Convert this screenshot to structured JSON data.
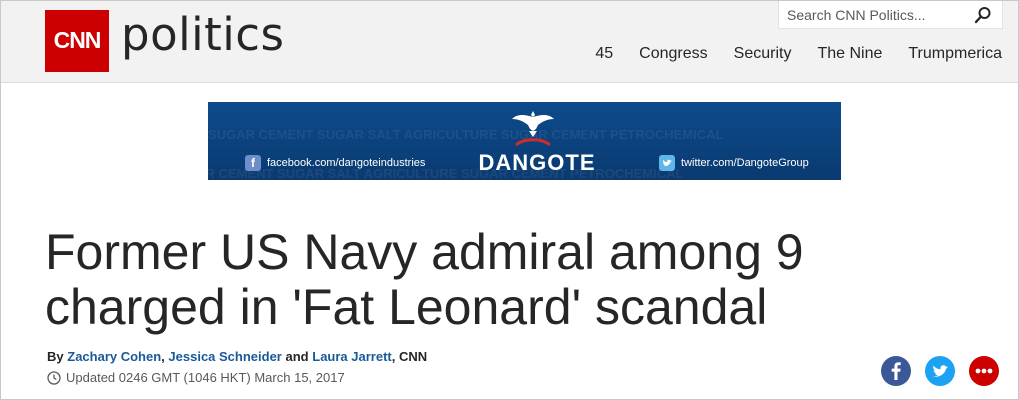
{
  "header": {
    "logo_text": "CNN",
    "section_title": "politics",
    "search": {
      "placeholder": "Search CNN Politics..."
    },
    "nav": [
      "45",
      "Congress",
      "Security",
      "The Nine",
      "Trumpmerica"
    ]
  },
  "ad": {
    "brand": "DANGOTE",
    "background_words": "SUGAR CEMENT SUGAR SALT AGRICULTURE SUGAR CEMENT PETROCHEMICAL",
    "facebook_text": "facebook.com/dangoteindustries",
    "twitter_text": "twitter.com/DangoteGroup"
  },
  "article": {
    "headline": "Former US Navy admiral among 9 charged in 'Fat Leonard' scandal",
    "byline_prefix": "By",
    "authors": [
      "Zachary Cohen",
      "Jessica Schneider",
      "Laura Jarrett"
    ],
    "byline_and": "and",
    "byline_suffix": ", CNN",
    "updated": "Updated 0246 GMT (1046 HKT) March 15, 2017"
  },
  "colors": {
    "cnn_red": "#cc0000",
    "facebook": "#3b5998",
    "twitter": "#1da1f2",
    "link": "#1a5a99"
  }
}
